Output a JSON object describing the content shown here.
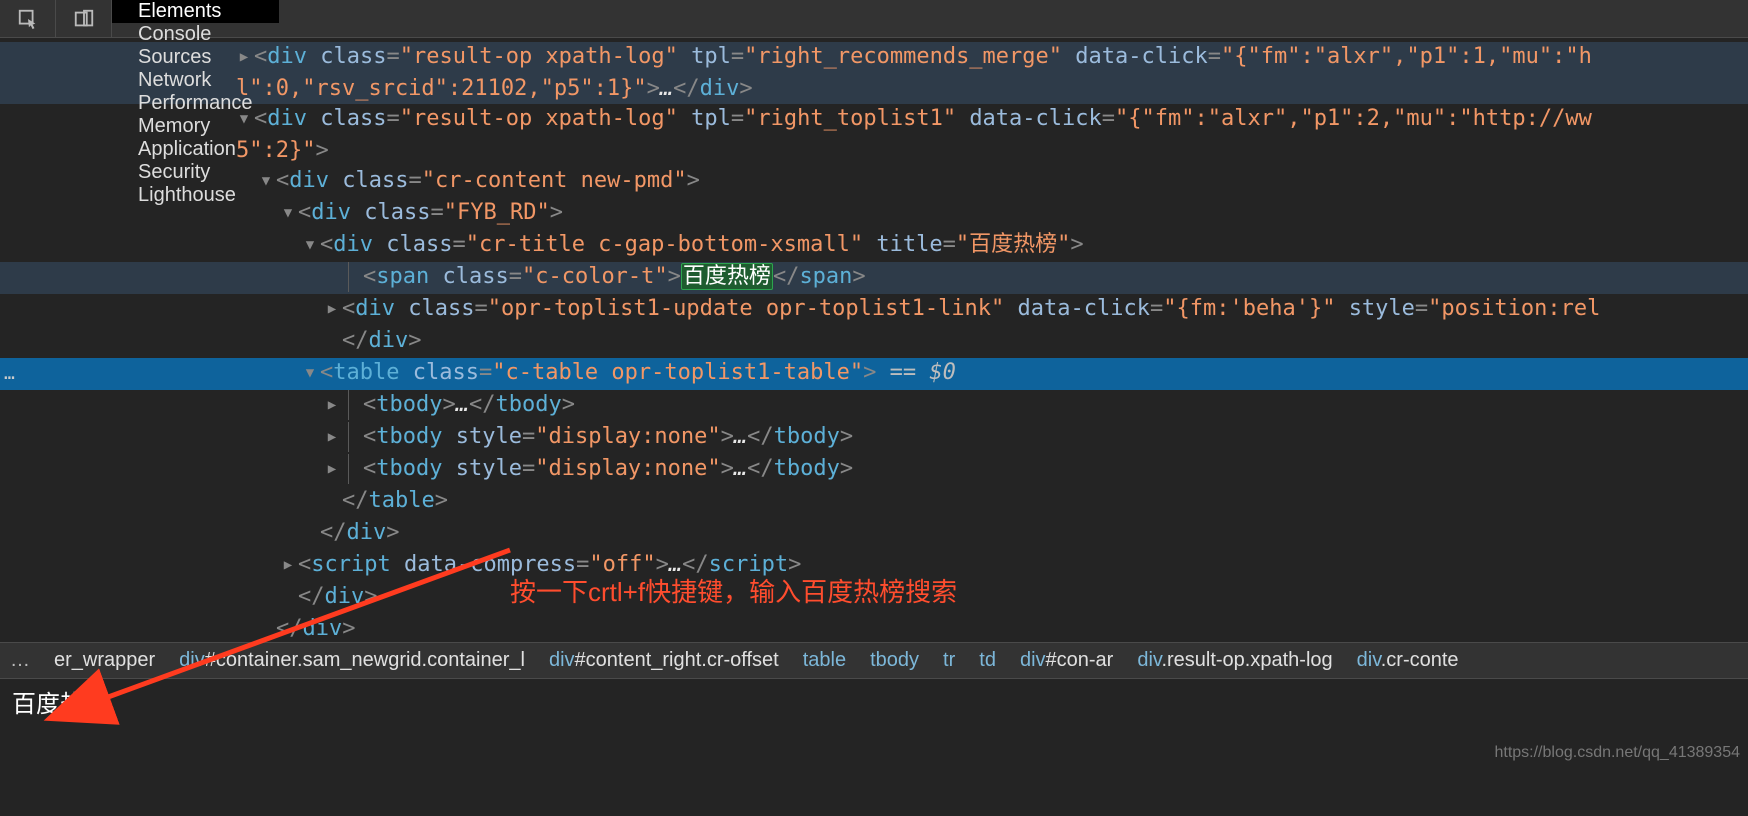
{
  "toolbar": {
    "tabs": [
      {
        "label": "Elements",
        "active": true
      },
      {
        "label": "Console",
        "active": false
      },
      {
        "label": "Sources",
        "active": false
      },
      {
        "label": "Network",
        "active": false
      },
      {
        "label": "Performance",
        "active": false
      },
      {
        "label": "Memory",
        "active": false
      },
      {
        "label": "Application",
        "active": false
      },
      {
        "label": "Security",
        "active": false
      },
      {
        "label": "Lighthouse",
        "active": false
      }
    ]
  },
  "tree": {
    "lines": [
      {
        "indent": 236,
        "arrow": "right",
        "row": "hover",
        "tokens": [
          {
            "p": "<"
          },
          {
            "tg": "div"
          },
          {
            "sp": true
          },
          {
            "at": "class"
          },
          {
            "eq": "="
          },
          {
            "st": "\"result-op xpath-log\""
          },
          {
            "sp": true
          },
          {
            "at": "tpl"
          },
          {
            "eq": "="
          },
          {
            "st": "\"right_recommends_merge\""
          },
          {
            "sp": true
          },
          {
            "at": "data-click"
          },
          {
            "eq": "="
          },
          {
            "st": "\"{\"fm\":\"alxr\",\"p1\":1,\"mu\":\"h"
          }
        ],
        "wrap": 236,
        "tokens2": [
          {
            "st": "l\":0,\"rsv_srcid\":21102,\"p5\":1}\""
          },
          {
            "p": ">"
          },
          {
            "el": "…"
          },
          {
            "p": "</"
          },
          {
            "tg": "div"
          },
          {
            "p": ">"
          }
        ]
      },
      {
        "indent": 236,
        "arrow": "down",
        "tokens": [
          {
            "p": "<"
          },
          {
            "tg": "div"
          },
          {
            "sp": true
          },
          {
            "at": "class"
          },
          {
            "eq": "="
          },
          {
            "st": "\"result-op xpath-log\""
          },
          {
            "sp": true
          },
          {
            "at": "tpl"
          },
          {
            "eq": "="
          },
          {
            "st": "\"right_toplist1\""
          },
          {
            "sp": true
          },
          {
            "at": "data-click"
          },
          {
            "eq": "="
          },
          {
            "st": "\"{\"fm\":\"alxr\",\"p1\":2,\"mu\":\"http://ww"
          }
        ],
        "wrap": 236,
        "tokens2": [
          {
            "st": "5\":2}\""
          },
          {
            "p": ">"
          }
        ]
      },
      {
        "indent": 258,
        "arrow": "down",
        "tokens": [
          {
            "p": "<"
          },
          {
            "tg": "div"
          },
          {
            "sp": true
          },
          {
            "at": "class"
          },
          {
            "eq": "="
          },
          {
            "st": "\"cr-content  new-pmd\""
          },
          {
            "p": ">"
          }
        ]
      },
      {
        "indent": 280,
        "arrow": "down",
        "tokens": [
          {
            "p": "<"
          },
          {
            "tg": "div"
          },
          {
            "sp": true
          },
          {
            "at": "class"
          },
          {
            "eq": "="
          },
          {
            "st": "\"FYB_RD\""
          },
          {
            "p": ">"
          }
        ]
      },
      {
        "indent": 302,
        "arrow": "down",
        "tokens": [
          {
            "p": "<"
          },
          {
            "tg": "div"
          },
          {
            "sp": true
          },
          {
            "at": "class"
          },
          {
            "eq": "="
          },
          {
            "st": "\"cr-title c-gap-bottom-xsmall\""
          },
          {
            "sp": true
          },
          {
            "at": "title"
          },
          {
            "eq": "="
          },
          {
            "st": "\"百度热榜\""
          },
          {
            "p": ">"
          }
        ]
      },
      {
        "indent": 324,
        "arrow": "none",
        "row": "hover",
        "guide": true,
        "tokens": [
          {
            "p": "<"
          },
          {
            "tg": "span"
          },
          {
            "sp": true
          },
          {
            "at": "class"
          },
          {
            "eq": "="
          },
          {
            "st": "\"c-color-t\""
          },
          {
            "p": ">"
          },
          {
            "hl": "百度热榜"
          },
          {
            "p": "</"
          },
          {
            "tg": "span"
          },
          {
            "p": ">"
          }
        ]
      },
      {
        "indent": 324,
        "arrow": "right",
        "tokens": [
          {
            "p": "<"
          },
          {
            "tg": "div"
          },
          {
            "sp": true
          },
          {
            "at": "class"
          },
          {
            "eq": "="
          },
          {
            "st": "\"opr-toplist1-update opr-toplist1-link\""
          },
          {
            "sp": true
          },
          {
            "at": "data-click"
          },
          {
            "eq": "="
          },
          {
            "st": "\"{fm:'beha'}\""
          },
          {
            "sp": true
          },
          {
            "at": "style"
          },
          {
            "eq": "="
          },
          {
            "st": "\"position:rel"
          }
        ]
      },
      {
        "indent": 324,
        "arrow": "none",
        "tokens": [
          {
            "p": "</"
          },
          {
            "tg": "div"
          },
          {
            "p": ">"
          }
        ]
      },
      {
        "indent": 302,
        "arrow": "down",
        "row": "selected",
        "selectedGutter": true,
        "tokens": [
          {
            "p": "<"
          },
          {
            "tg": "table"
          },
          {
            "sp": true
          },
          {
            "at": "class"
          },
          {
            "eq": "="
          },
          {
            "st": "\"c-table opr-toplist1-table\""
          },
          {
            "p": ">"
          },
          {
            "sp": true
          },
          {
            "mut": "== $0"
          }
        ]
      },
      {
        "indent": 324,
        "arrow": "right",
        "guide": true,
        "tokens": [
          {
            "p": "<"
          },
          {
            "tg": "tbody"
          },
          {
            "p": ">"
          },
          {
            "el": "…"
          },
          {
            "p": "</"
          },
          {
            "tg": "tbody"
          },
          {
            "p": ">"
          }
        ]
      },
      {
        "indent": 324,
        "arrow": "right",
        "guide": true,
        "tokens": [
          {
            "p": "<"
          },
          {
            "tg": "tbody"
          },
          {
            "sp": true
          },
          {
            "at": "style"
          },
          {
            "eq": "="
          },
          {
            "st": "\"display:none\""
          },
          {
            "p": ">"
          },
          {
            "el": "…"
          },
          {
            "p": "</"
          },
          {
            "tg": "tbody"
          },
          {
            "p": ">"
          }
        ]
      },
      {
        "indent": 324,
        "arrow": "right",
        "guide": true,
        "tokens": [
          {
            "p": "<"
          },
          {
            "tg": "tbody"
          },
          {
            "sp": true
          },
          {
            "at": "style"
          },
          {
            "eq": "="
          },
          {
            "st": "\"display:none\""
          },
          {
            "p": ">"
          },
          {
            "el": "…"
          },
          {
            "p": "</"
          },
          {
            "tg": "tbody"
          },
          {
            "p": ">"
          }
        ]
      },
      {
        "indent": 324,
        "arrow": "none",
        "tokens": [
          {
            "p": "</"
          },
          {
            "tg": "table"
          },
          {
            "p": ">"
          }
        ]
      },
      {
        "indent": 302,
        "arrow": "none",
        "tokens": [
          {
            "p": "</"
          },
          {
            "tg": "div"
          },
          {
            "p": ">"
          }
        ]
      },
      {
        "indent": 280,
        "arrow": "right",
        "tokens": [
          {
            "p": "<"
          },
          {
            "tg": "script"
          },
          {
            "sp": true
          },
          {
            "at": "data-compress"
          },
          {
            "eq": "="
          },
          {
            "st": "\"off\""
          },
          {
            "p": ">"
          },
          {
            "el": "…"
          },
          {
            "p": "</"
          },
          {
            "tg": "script"
          },
          {
            "p": ">"
          }
        ]
      },
      {
        "indent": 280,
        "arrow": "none",
        "tokens": [
          {
            "p": "</"
          },
          {
            "tg": "div"
          },
          {
            "p": ">"
          }
        ]
      },
      {
        "indent": 258,
        "arrow": "none",
        "tokens": [
          {
            "p": "</"
          },
          {
            "tg": "div"
          },
          {
            "p": ">"
          }
        ]
      },
      {
        "indent": 236,
        "arrow": "none",
        "tokens": [
          {
            "p": "</"
          },
          {
            "tg": "div"
          },
          {
            "p": ">"
          }
        ]
      },
      {
        "indent": 214,
        "arrow": "none",
        "tokens": [
          {
            "p": "</"
          },
          {
            "tg": "div"
          },
          {
            "p": ">"
          }
        ]
      }
    ]
  },
  "annotation": "按一下crtl+f快捷键，输入百度热榜搜索",
  "breadcrumb": {
    "more": "…",
    "items": [
      {
        "tag": "",
        "idcls": "er_wrapper"
      },
      {
        "tag": "div",
        "idcls": "#container.sam_newgrid.container_l"
      },
      {
        "tag": "div",
        "idcls": "#content_right.cr-offset"
      },
      {
        "tag": "table",
        "idcls": ""
      },
      {
        "tag": "tbody",
        "idcls": ""
      },
      {
        "tag": "tr",
        "idcls": ""
      },
      {
        "tag": "td",
        "idcls": ""
      },
      {
        "tag": "div",
        "idcls": "#con-ar"
      },
      {
        "tag": "div",
        "idcls": ".result-op.xpath-log"
      },
      {
        "tag": "div",
        "idcls": ".cr-conte"
      }
    ]
  },
  "search": {
    "value": "百度热榜"
  },
  "watermark": "https://blog.csdn.net/qq_41389354"
}
